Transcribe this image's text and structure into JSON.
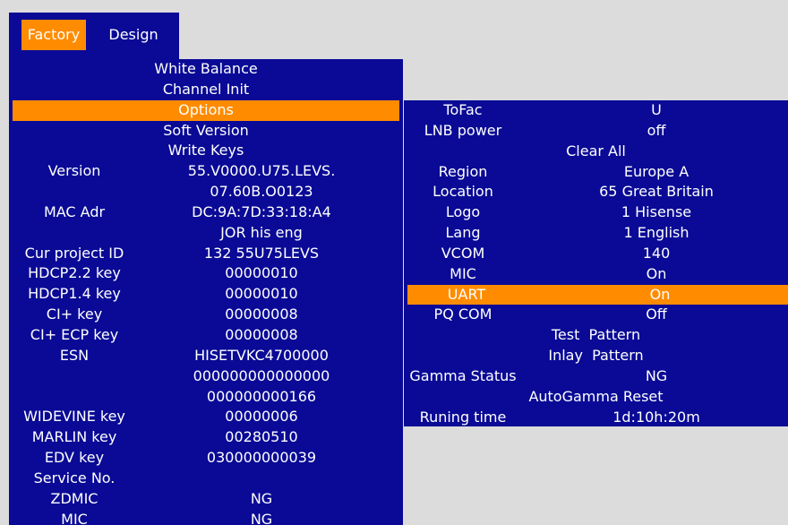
{
  "tabs": {
    "factory": "Factory",
    "design": "Design"
  },
  "left_menu": {
    "items": [
      {
        "label": "White Balance"
      },
      {
        "label": "Channel Init"
      },
      {
        "label": "Options",
        "selected": true
      },
      {
        "label": "Soft Version"
      },
      {
        "label": "Write Keys"
      }
    ],
    "info": [
      {
        "label": "Version",
        "value": "55.V0000.U75.LEVS."
      },
      {
        "label": "",
        "value": "07.60B.O0123"
      },
      {
        "label": "MAC Adr",
        "value": "DC:9A:7D:33:18:A4"
      },
      {
        "label": "",
        "value": "JOR his eng"
      },
      {
        "label": "Cur project ID",
        "value": "132 55U75LEVS"
      },
      {
        "label": "HDCP2.2 key",
        "value": "00000010"
      },
      {
        "label": "HDCP1.4 key",
        "value": "00000010"
      },
      {
        "label": "CI+ key",
        "value": "00000008"
      },
      {
        "label": "CI+ ECP key",
        "value": "00000008"
      },
      {
        "label": "ESN",
        "value": "HISETVKC4700000"
      },
      {
        "label": "",
        "value": "000000000000000"
      },
      {
        "label": "",
        "value": "000000000166"
      },
      {
        "label": "WIDEVINE key",
        "value": "00000006"
      },
      {
        "label": "MARLIN key",
        "value": "00280510"
      },
      {
        "label": "EDV key",
        "value": "030000000039"
      },
      {
        "label": "Service No.",
        "value": ""
      },
      {
        "label": "ZDMIC",
        "value": "NG"
      },
      {
        "label": "MIC",
        "value": "NG"
      }
    ]
  },
  "options": {
    "rows": [
      {
        "label": "ToFac",
        "value": "U"
      },
      {
        "label": "LNB power",
        "value": "off"
      },
      {
        "full": "Clear All"
      },
      {
        "label": "Region",
        "value": "Europe A"
      },
      {
        "label": "Location",
        "value": "65 Great Britain"
      },
      {
        "label": "Logo",
        "value": "1 Hisense"
      },
      {
        "label": "Lang",
        "value": "1 English"
      },
      {
        "label": "VCOM",
        "value": "140"
      },
      {
        "label": "MIC",
        "value": "On"
      },
      {
        "label": "UART",
        "value": "On",
        "selected": true
      },
      {
        "label": "PQ COM",
        "value": "Off"
      },
      {
        "full": "Test  Pattern"
      },
      {
        "full": "Inlay  Pattern"
      },
      {
        "label": "Gamma Status",
        "value": "NG"
      },
      {
        "full": "AutoGamma Reset"
      },
      {
        "label": "Runing time",
        "value": "1d:10h:20m"
      }
    ]
  },
  "colors": {
    "panel": "#0a0a96",
    "highlight": "#ff8c00",
    "background": "#dcdcdc",
    "text": "#ffffff"
  }
}
